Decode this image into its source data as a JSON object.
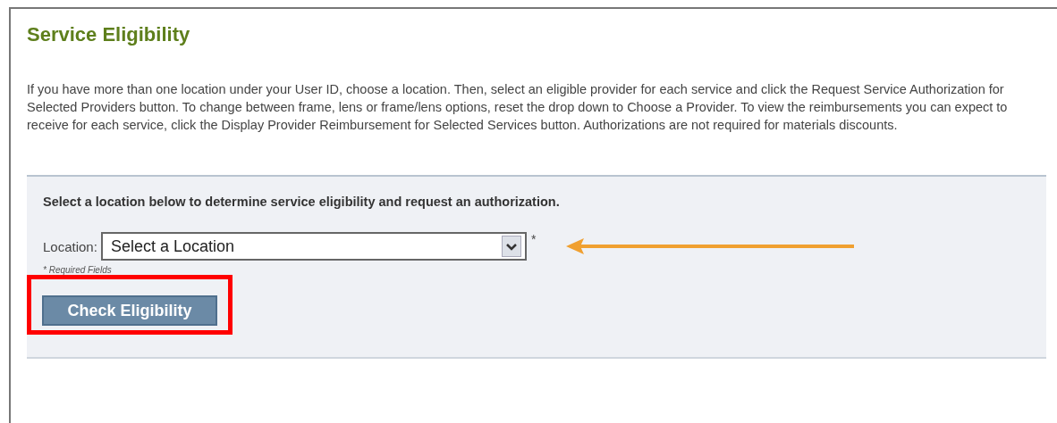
{
  "title": "Service Eligibility",
  "description": "If you have more than one location under your User ID, choose a location. Then, select an eligible provider for each service and click the Request Service Authorization for Selected Providers button. To change between frame, lens or frame/lens options, reset the drop down to Choose a Provider. To view the reimbursements you can expect to receive for each service, click the Display Provider Reimbursement for Selected Services button. Authorizations are not required for materials discounts.",
  "form": {
    "instruction": "Select a location below to determine service eligibility and request an authorization.",
    "location_label": "Location:",
    "location_value": "Select a Location",
    "required_mark": "*",
    "required_note": "* Required Fields",
    "button": "Check Eligibility"
  }
}
